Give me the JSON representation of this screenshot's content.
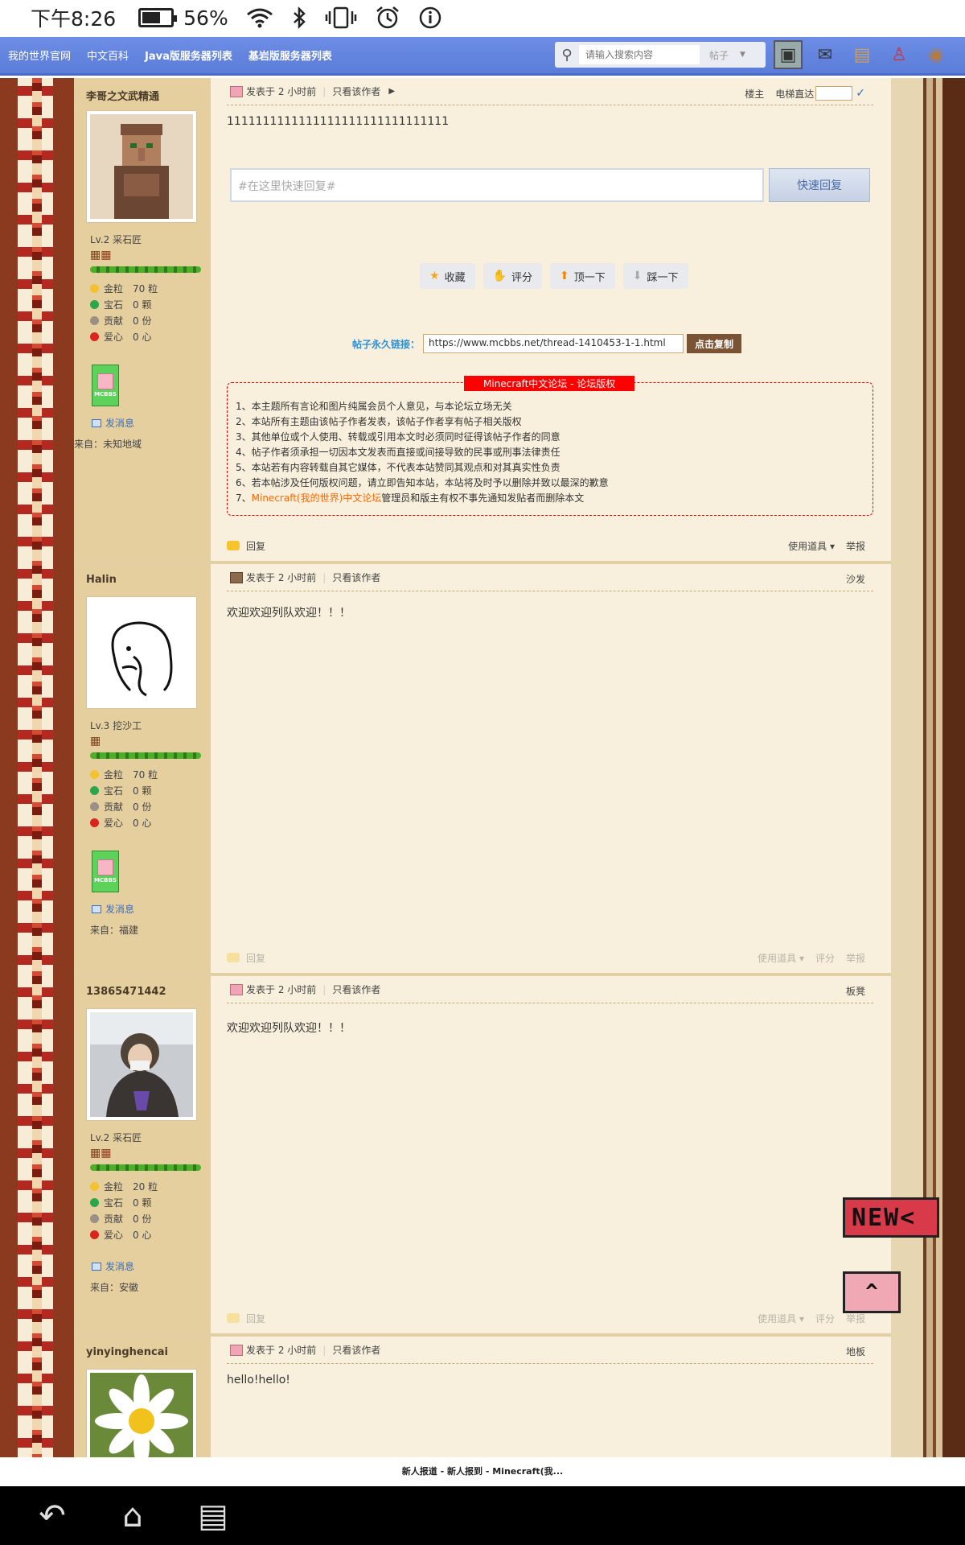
{
  "status": {
    "time": "下午8:26",
    "battery": "56%"
  },
  "nav": {
    "links": [
      "我的世界官网",
      "中文百科",
      "Java版服务器列表",
      "基岩版服务器列表"
    ],
    "search_placeholder": "请输入搜索内容",
    "search_type": "帖子"
  },
  "thread": {
    "floor_label": "楼主",
    "elevator_label": "电梯直达",
    "quick_reply_placeholder": "#在这里快速回复#",
    "quick_reply_button": "快速回复",
    "actions": [
      "收藏",
      "评分",
      "顶一下",
      "踩一下"
    ],
    "permalink_label": "帖子永久链接：",
    "permalink_url": "https://www.mcbbs.net/thread-1410453-1-1.html",
    "copy_button": "点击复制",
    "copyright_title": "Minecraft中文论坛 - 论坛版权",
    "copyright": [
      "1、本主题所有言论和图片纯属会员个人意见，与本论坛立场无关",
      "2、本站所有主题由该帖子作者发表，该帖子作者享有帖子相关版权",
      "3、其他单位或个人使用、转载或引用本文时必须同时征得该帖子作者的同意",
      "4、帖子作者须承担一切因本文发表而直接或间接导致的民事或刑事法律责任",
      "5、本站若有内容转载自其它媒体，不代表本站赞同其观点和对其真实性负责",
      "6、若本帖涉及任何版权问题，请立即告知本站，本站将及时予以删除并致以最深的歉意"
    ],
    "copyright_7_prefix": "7、",
    "copyright_7_org": "Minecraft(我的世界)中文论坛",
    "copyright_7_suffix": "管理员和版主有权不事先通知发贴者而删除本文",
    "reply": "回复",
    "tools": "使用道具",
    "rate": "评分",
    "report": "举报"
  },
  "stat_labels": {
    "gold": "金粒",
    "gem": "宝石",
    "contrib": "贡献",
    "love": "爱心"
  },
  "common": {
    "posted": "发表于 2 小时前",
    "only_author": "只看该作者",
    "send_msg": "发消息"
  },
  "posts": [
    {
      "author": "李哥之文武精通",
      "level": "Lv.2 采石匠",
      "gold": "70 粒",
      "gem": "0 颗",
      "contrib": "0 份",
      "love": "0 心",
      "from": "来自：未知地域",
      "floor": "",
      "content": "1111111111111111111111111111111"
    },
    {
      "author": "Halin",
      "level": "Lv.3 挖沙工",
      "gold": "70 粒",
      "gem": "0 颗",
      "contrib": "0 份",
      "love": "0 心",
      "from": "来自：福建",
      "floor": "沙发",
      "content": "欢迎欢迎列队欢迎！！！"
    },
    {
      "author": "13865471442",
      "level": "Lv.2 采石匠",
      "gold": "20 粒",
      "gem": "0 颗",
      "contrib": "0 份",
      "love": "0 心",
      "from": "来自：安徽",
      "floor": "板凳",
      "content": "欢迎欢迎列队欢迎！！！"
    },
    {
      "author": "yinyinghencai",
      "floor": "地板",
      "content": "hello!hello!"
    }
  ],
  "badge_text": "MCBBS",
  "float": {
    "news": "NEW<"
  },
  "tab_title": "新人报道 - 新人报到 - Minecraft(我..."
}
